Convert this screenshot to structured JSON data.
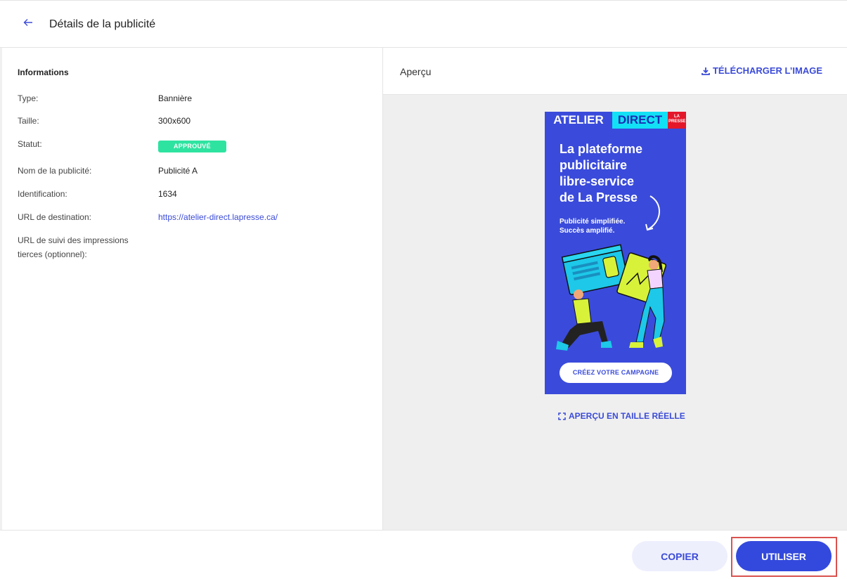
{
  "header": {
    "back_icon": "arrow-left-icon",
    "title": "Détails de la publicité"
  },
  "info": {
    "section_title": "Informations",
    "rows": [
      {
        "label": "Type:",
        "value": "Bannière"
      },
      {
        "label": "Taille:",
        "value": "300x600"
      },
      {
        "label": "Statut:",
        "value": "APPROUVÉ"
      },
      {
        "label": "Nom de la publicité:",
        "value": "Publicité A"
      },
      {
        "label": "Identification:",
        "value": "1634"
      },
      {
        "label": "URL de destination:",
        "value": "https://atelier-direct.lapresse.ca/"
      },
      {
        "label": "URL de suivi des impressions tierces (optionnel):",
        "value": ""
      }
    ],
    "status_color": "#2ee3a0"
  },
  "preview": {
    "label": "Aperçu",
    "download_label": "TÉLÉCHARGER L’IMAGE",
    "download_icon": "download-icon",
    "fullsize_label": "APERÇU EN TAILLE RÉELLE",
    "fullsize_icon": "expand-icon"
  },
  "ad": {
    "brand_left": "ATELIER",
    "brand_right": "DIRECT",
    "brand_logo": "LA PRESSE",
    "headline": "La plateforme\npublicitaire\nlibre-service\nde La Presse",
    "tagline": "Publicité simplifiée.\nSuccès amplifié.",
    "cta": "CRÉEZ VOTRE CAMPAGNE",
    "background_color": "#3a4bdb",
    "accent_color": "#12e0f5",
    "logo_color": "#e4172a"
  },
  "footer": {
    "copy_label": "COPIER",
    "use_label": "UTILISER",
    "accent_color": "#3349dd",
    "highlight_color": "#d9534f"
  }
}
